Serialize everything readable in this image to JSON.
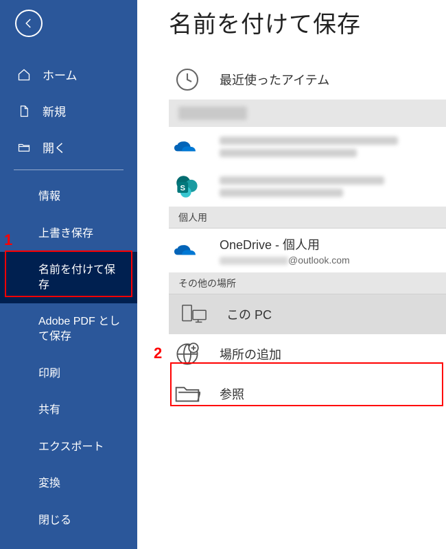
{
  "sidebar": {
    "top": [
      {
        "label": "ホーム"
      },
      {
        "label": "新規"
      },
      {
        "label": "開く"
      }
    ],
    "sub": [
      {
        "label": "情報"
      },
      {
        "label": "上書き保存"
      },
      {
        "label": "名前を付けて保存"
      },
      {
        "label": "Adobe PDF として保存"
      },
      {
        "label": "印刷"
      },
      {
        "label": "共有"
      },
      {
        "label": "エクスポート"
      },
      {
        "label": "変換"
      },
      {
        "label": "閉じる"
      }
    ]
  },
  "main": {
    "title": "名前を付けて保存",
    "recent": "最近使ったアイテム",
    "section_personal": "個人用",
    "onedrive_personal": "OneDrive - 個人用",
    "onedrive_email_suffix": "@outlook.com",
    "section_other": "その他の場所",
    "this_pc": "この PC",
    "add_location": "場所の追加",
    "browse": "参照"
  },
  "annotations": {
    "one": "1",
    "two": "2"
  }
}
